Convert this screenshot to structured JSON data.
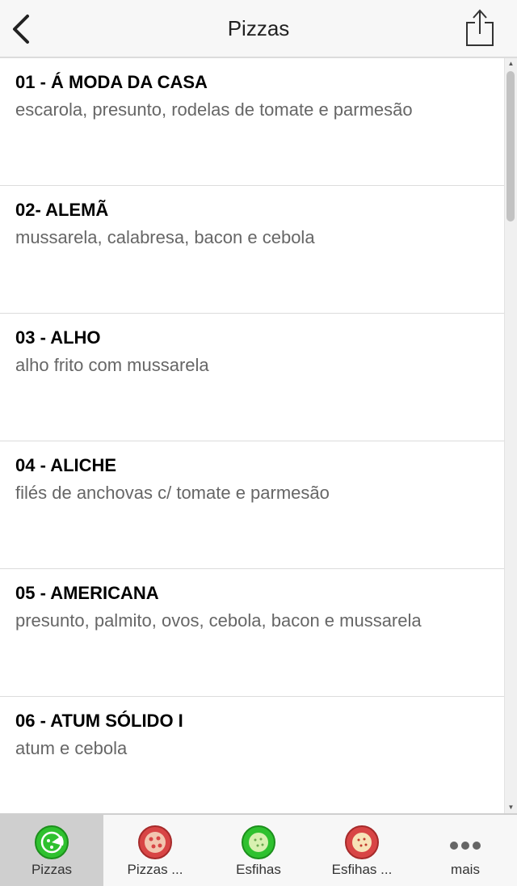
{
  "header": {
    "title": "Pizzas",
    "back_icon": "chevron-left-icon",
    "share_icon": "share-icon"
  },
  "items": [
    {
      "name": "01 - Á MODA DA CASA",
      "description": "escarola, presunto, rodelas de tomate e parmesão"
    },
    {
      "name": "02- ALEMÃ",
      "description": "mussarela, calabresa, bacon e cebola"
    },
    {
      "name": "03 - ALHO",
      "description": "alho frito com mussarela"
    },
    {
      "name": "04 - ALICHE",
      "description": "filés de anchovas c/ tomate e parmesão"
    },
    {
      "name": "05 - AMERICANA",
      "description": "presunto, palmito, ovos, cebola, bacon e mussarela"
    },
    {
      "name": "06 - ATUM SÓLIDO I",
      "description": "atum e cebola"
    }
  ],
  "tabs": [
    {
      "label": "Pizzas",
      "icon": "pizza-green-icon",
      "active": true
    },
    {
      "label": "Pizzas ...",
      "icon": "pizza-red-icon",
      "active": false
    },
    {
      "label": "Esfihas",
      "icon": "esfiha-green-icon",
      "active": false
    },
    {
      "label": "Esfihas ...",
      "icon": "esfiha-red-icon",
      "active": false
    },
    {
      "label": "mais",
      "icon": "more-icon",
      "active": false
    }
  ],
  "colors": {
    "green": "#2fc12f",
    "red": "#d84545",
    "active_tab_bg": "#cfcfcf"
  }
}
